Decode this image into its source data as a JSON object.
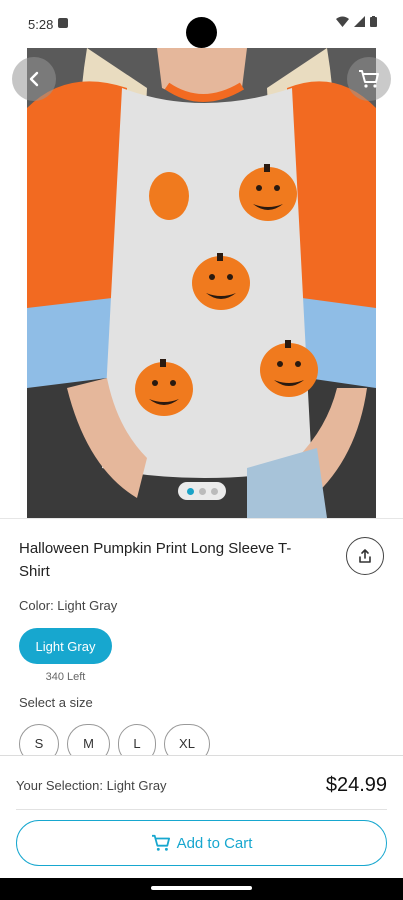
{
  "status": {
    "time": "5:28"
  },
  "hero": {
    "back_icon": "back-arrow-icon",
    "cart_icon": "cart-icon",
    "image_count": 3,
    "active_image": 1
  },
  "product": {
    "title": "Halloween Pumpkin Print Long Sleeve T-Shirt",
    "share_icon": "share-icon",
    "color_label": "Color: Light Gray",
    "selected_color": "Light Gray",
    "stock_left": "340 Left",
    "size_label": "Select a size",
    "sizes": [
      "S",
      "M",
      "L",
      "XL"
    ]
  },
  "footer": {
    "selection": "Your Selection: Light Gray",
    "price": "$24.99",
    "add_to_cart": "Add to Cart"
  },
  "colors": {
    "accent": "#17a7cf"
  }
}
